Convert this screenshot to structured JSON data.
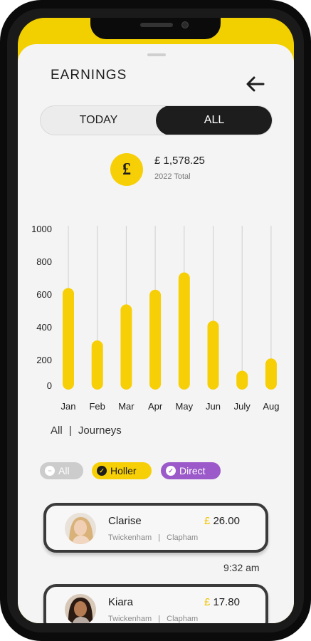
{
  "header": {
    "title": "EARNINGS"
  },
  "toggle": {
    "today_label": "TODAY",
    "all_label": "ALL",
    "active": "ALL"
  },
  "summary": {
    "currency_symbol": "£",
    "amount": "£ 1,578.25",
    "label": "2022 Total"
  },
  "chart_data": {
    "type": "bar",
    "categories": [
      "Jan",
      "Feb",
      "Mar",
      "Apr",
      "May",
      "Jun",
      "July",
      "Aug"
    ],
    "values": [
      620,
      300,
      520,
      610,
      715,
      420,
      115,
      190
    ],
    "ytick_labels": [
      "1000",
      "800",
      "600",
      "400",
      "200",
      "0"
    ],
    "ylim": [
      0,
      1000
    ],
    "bar_color": "#f7cf06",
    "grid": true,
    "title": "",
    "xlabel": "",
    "ylabel": ""
  },
  "filters": {
    "label_all": "All",
    "separator": "|",
    "label_journeys": "Journeys",
    "pills": [
      {
        "label": "All",
        "color": "#cccccc",
        "icon": "minus-circle-icon"
      },
      {
        "label": "Holler",
        "color": "#f7cf06",
        "icon": "check-circle-icon"
      },
      {
        "label": "Direct",
        "color": "#9b59c9",
        "icon": "check-circle-icon"
      }
    ]
  },
  "journeys": [
    {
      "name": "Clarise",
      "from": "Twickenham",
      "to": "Clapham",
      "currency": "£",
      "amount": "26.00",
      "time": "9:32 am"
    },
    {
      "name": "Kiara",
      "from": "Twickenham",
      "to": "Clapham",
      "currency": "£",
      "amount": "17.80"
    }
  ],
  "colors": {
    "accent": "#f7cf06",
    "dark": "#1d1d1d",
    "purple": "#9b59c9",
    "background": "#f4f4f4"
  }
}
